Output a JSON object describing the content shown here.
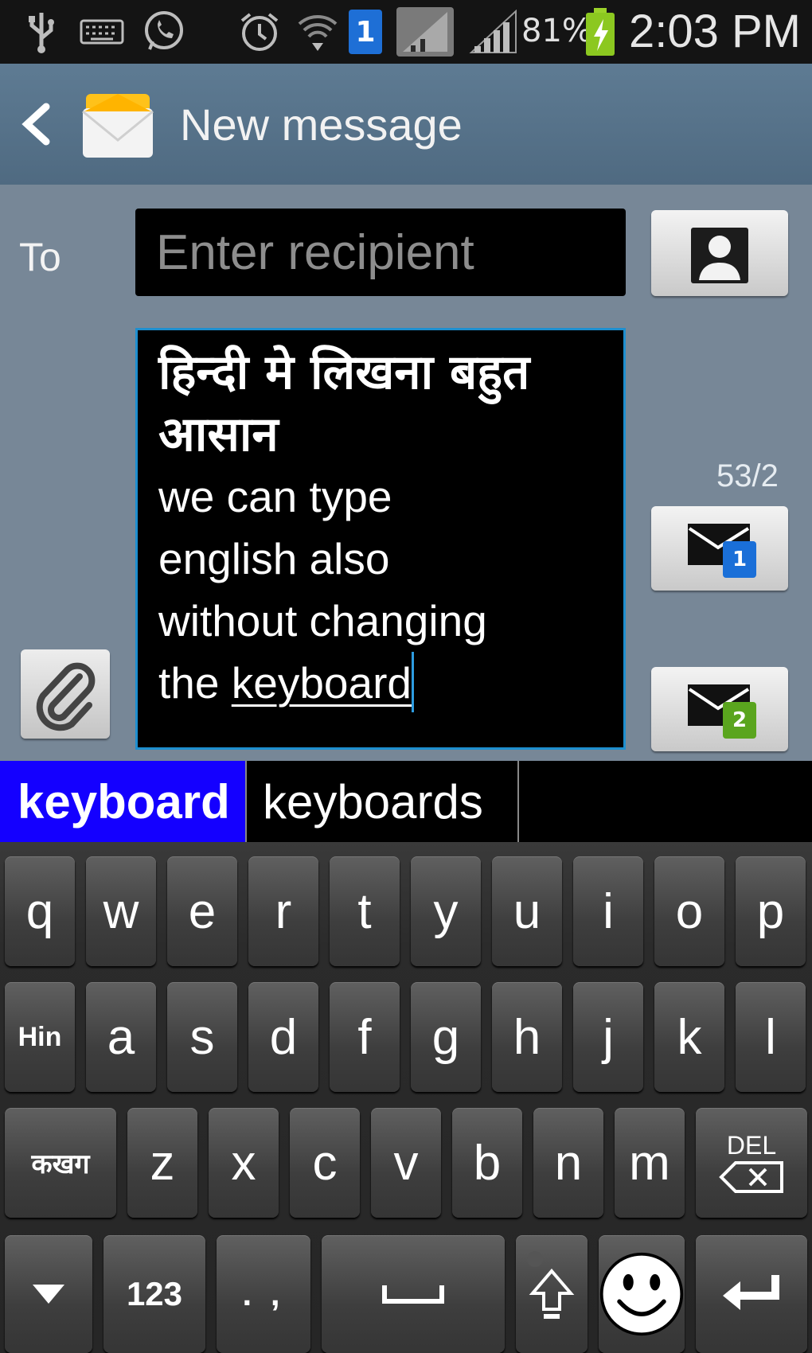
{
  "status_bar": {
    "sim_number": "1",
    "battery_percent": "81%",
    "time": "2:03 PM",
    "icons": [
      "usb-icon",
      "keyboard-icon",
      "whatsapp-icon",
      "alarm-icon",
      "wifi-icon",
      "sim-1-icon",
      "no-signal-icon",
      "signal-icon",
      "battery-charging-icon"
    ]
  },
  "action_bar": {
    "title": "New message",
    "back_icon": "chevron-left-icon",
    "app_icon": "envelope-icon"
  },
  "compose": {
    "to_label": "To",
    "recipient_placeholder": "Enter recipient",
    "message_lines": [
      "हिन्दी मे लिखना बहुत",
      "आसान",
      "we can type",
      "english also",
      "without changing"
    ],
    "last_line_prefix": "the ",
    "last_line_underlined": "keyboard",
    "counter": "53/2",
    "send_sim1_badge": "1",
    "send_sim2_badge": "2",
    "sim1_color": "#1a6fd8",
    "sim2_color": "#5aa51e"
  },
  "suggestions": [
    "keyboard",
    "keyboards"
  ],
  "keyboard": {
    "row1": [
      "q",
      "w",
      "e",
      "r",
      "t",
      "y",
      "u",
      "i",
      "o",
      "p"
    ],
    "row2_lang": "Hin",
    "row2": [
      "a",
      "s",
      "d",
      "f",
      "g",
      "h",
      "j",
      "k",
      "l"
    ],
    "row3_script": "कखग",
    "row3": [
      "z",
      "x",
      "c",
      "v",
      "b",
      "n",
      "m"
    ],
    "del_label": "DEL",
    "numbers_label": "123",
    "punct_label": ". ,"
  }
}
